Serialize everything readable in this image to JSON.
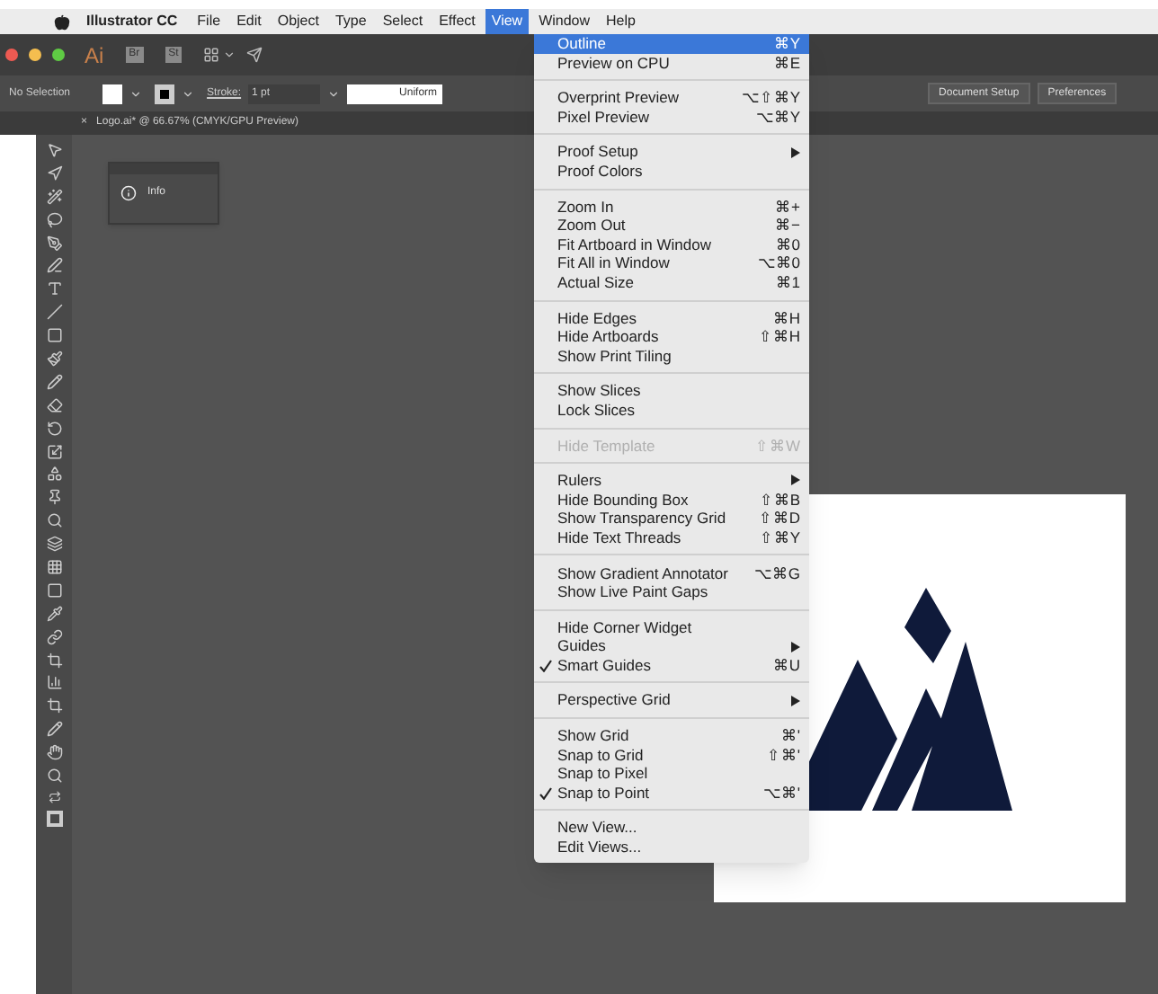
{
  "menu_bar": {
    "app_name": "Illustrator CC",
    "items": [
      {
        "label": "File",
        "selected": false
      },
      {
        "label": "Edit",
        "selected": false
      },
      {
        "label": "Object",
        "selected": false
      },
      {
        "label": "Type",
        "selected": false
      },
      {
        "label": "Select",
        "selected": false
      },
      {
        "label": "Effect",
        "selected": false
      },
      {
        "label": "View",
        "selected": true
      },
      {
        "label": "Window",
        "selected": false
      },
      {
        "label": "Help",
        "selected": false
      }
    ]
  },
  "app_bar": {
    "logo": "Ai",
    "buttons": [
      "Br",
      "St"
    ]
  },
  "control_bar": {
    "selection": "No Selection",
    "stroke_label": "Stroke:",
    "stroke_weight": "1 pt",
    "profile": "Uniform",
    "buttons": [
      "Document Setup",
      "Preferences"
    ]
  },
  "document_tab": {
    "close": "×",
    "title": "Logo.ai* @ 66.67% (CMYK/GPU Preview)"
  },
  "info_panel": {
    "label": "Info"
  },
  "view_menu": {
    "sections": [
      [
        {
          "label": "Outline",
          "shortcut": "⌘Y",
          "selected": true,
          "checked": false,
          "disabled": false,
          "submenu": false
        },
        {
          "label": "Preview on CPU",
          "shortcut": "⌘E",
          "selected": false,
          "checked": false,
          "disabled": false,
          "submenu": false
        }
      ],
      [
        {
          "label": "Overprint Preview",
          "shortcut": "⌥⇧⌘Y",
          "selected": false,
          "checked": false,
          "disabled": false,
          "submenu": false
        },
        {
          "label": "Pixel Preview",
          "shortcut": "⌥⌘Y",
          "selected": false,
          "checked": false,
          "disabled": false,
          "submenu": false
        }
      ],
      [
        {
          "label": "Proof Setup",
          "selected": false,
          "checked": false,
          "disabled": false,
          "submenu": true
        },
        {
          "label": "Proof Colors",
          "selected": false,
          "checked": false,
          "disabled": false,
          "submenu": false
        }
      ],
      [
        {
          "label": "Zoom In",
          "shortcut": "⌘+",
          "selected": false,
          "checked": false,
          "disabled": false,
          "submenu": false
        },
        {
          "label": "Zoom Out",
          "shortcut": "⌘−",
          "selected": false,
          "checked": false,
          "disabled": false,
          "submenu": false
        },
        {
          "label": "Fit Artboard in Window",
          "shortcut": "⌘0",
          "selected": false,
          "checked": false,
          "disabled": false,
          "submenu": false
        },
        {
          "label": "Fit All in Window",
          "shortcut": "⌥⌘0",
          "selected": false,
          "checked": false,
          "disabled": false,
          "submenu": false
        },
        {
          "label": "Actual Size",
          "shortcut": "⌘1",
          "selected": false,
          "checked": false,
          "disabled": false,
          "submenu": false
        }
      ],
      [
        {
          "label": "Hide Edges",
          "shortcut": "⌘H",
          "selected": false,
          "checked": false,
          "disabled": false,
          "submenu": false
        },
        {
          "label": "Hide Artboards",
          "shortcut": "⇧⌘H",
          "selected": false,
          "checked": false,
          "disabled": false,
          "submenu": false
        },
        {
          "label": "Show Print Tiling",
          "selected": false,
          "checked": false,
          "disabled": false,
          "submenu": false
        }
      ],
      [
        {
          "label": "Show Slices",
          "selected": false,
          "checked": false,
          "disabled": false,
          "submenu": false
        },
        {
          "label": "Lock Slices",
          "selected": false,
          "checked": false,
          "disabled": false,
          "submenu": false
        }
      ],
      [
        {
          "label": "Hide Template",
          "shortcut": "⇧⌘W",
          "selected": false,
          "checked": false,
          "disabled": true,
          "submenu": false
        }
      ],
      [
        {
          "label": "Rulers",
          "selected": false,
          "checked": false,
          "disabled": false,
          "submenu": true
        },
        {
          "label": "Hide Bounding Box",
          "shortcut": "⇧⌘B",
          "selected": false,
          "checked": false,
          "disabled": false,
          "submenu": false
        },
        {
          "label": "Show Transparency Grid",
          "shortcut": "⇧⌘D",
          "selected": false,
          "checked": false,
          "disabled": false,
          "submenu": false
        },
        {
          "label": "Hide Text Threads",
          "shortcut": "⇧⌘Y",
          "selected": false,
          "checked": false,
          "disabled": false,
          "submenu": false
        }
      ],
      [
        {
          "label": "Show Gradient Annotator",
          "shortcut": "⌥⌘G",
          "selected": false,
          "checked": false,
          "disabled": false,
          "submenu": false
        },
        {
          "label": "Show Live Paint Gaps",
          "selected": false,
          "checked": false,
          "disabled": false,
          "submenu": false
        }
      ],
      [
        {
          "label": "Hide Corner Widget",
          "selected": false,
          "checked": false,
          "disabled": false,
          "submenu": false
        },
        {
          "label": "Guides",
          "selected": false,
          "checked": false,
          "disabled": false,
          "submenu": true
        },
        {
          "label": "Smart Guides",
          "shortcut": "⌘U",
          "selected": false,
          "checked": true,
          "disabled": false,
          "submenu": false
        }
      ],
      [
        {
          "label": "Perspective Grid",
          "selected": false,
          "checked": false,
          "disabled": false,
          "submenu": true
        }
      ],
      [
        {
          "label": "Show Grid",
          "shortcut": "⌘'",
          "selected": false,
          "checked": false,
          "disabled": false,
          "submenu": false
        },
        {
          "label": "Snap to Grid",
          "shortcut": "⇧⌘'",
          "selected": false,
          "checked": false,
          "disabled": false,
          "submenu": false
        },
        {
          "label": "Snap to Pixel",
          "selected": false,
          "checked": false,
          "disabled": false,
          "submenu": false
        },
        {
          "label": "Snap to Point",
          "shortcut": "⌥⌘'",
          "selected": false,
          "checked": true,
          "disabled": false,
          "submenu": false
        }
      ],
      [
        {
          "label": "New View...",
          "selected": false,
          "checked": false,
          "disabled": false,
          "submenu": false
        },
        {
          "label": "Edit Views...",
          "selected": false,
          "checked": false,
          "disabled": false,
          "submenu": false
        }
      ]
    ]
  }
}
